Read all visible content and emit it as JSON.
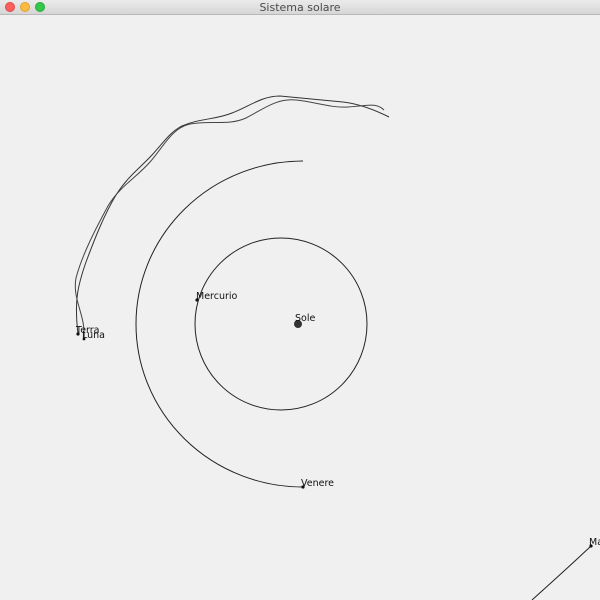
{
  "window": {
    "title": "Sistema solare"
  },
  "controls": {
    "close_color": "#fc605c",
    "minimize_color": "#fdbc40",
    "zoom_color": "#34c84a"
  },
  "bodies": {
    "sun": "Sole",
    "mercury": "Mercurio",
    "venus": "Venere",
    "earth": "Terra",
    "moon": "Luna",
    "mars": "Ma"
  }
}
